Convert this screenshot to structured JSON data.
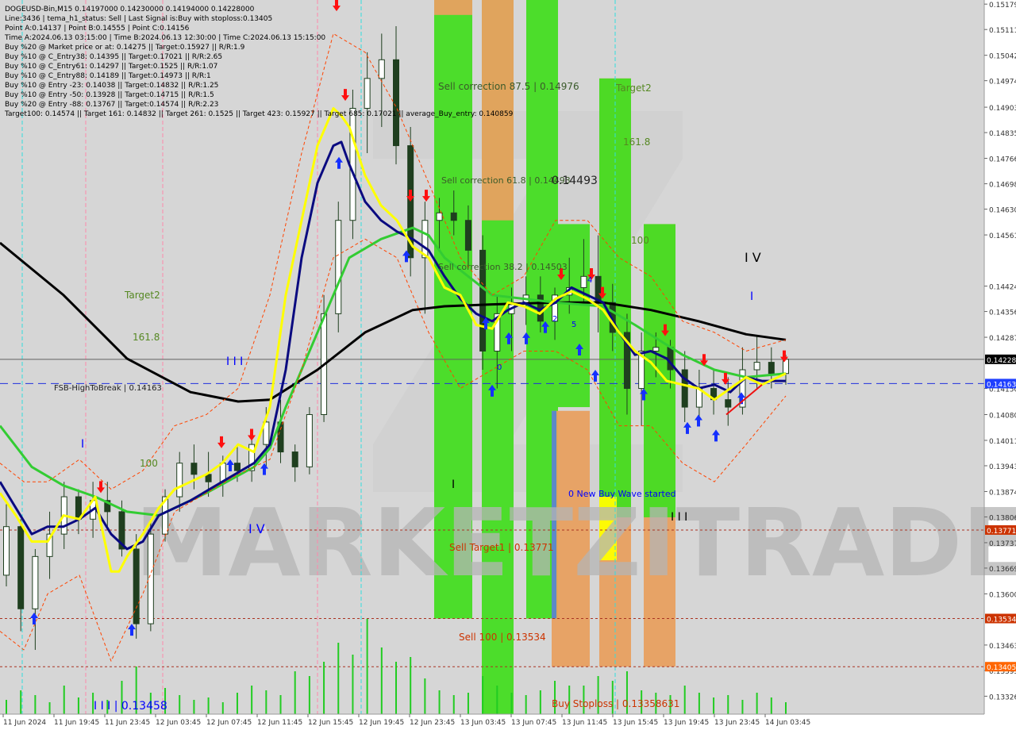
{
  "header": {
    "title": "DOGEUSD-Bin,M15  0.14197000 0.14230000 0.14194000 0.14228000",
    "lines": [
      "Line:3436 | tema_h1_status: Sell | Last Signal is:Buy with stoploss:0.13405",
      "Point A:0.14137 | Point B:0.14555 | Point C:0.14156",
      "Time A:2024.06.13 03:15:00 | Time B:2024.06.13 12:30:00 | Time C:2024.06.13 15:15:00",
      "Buy %20 @ Market price or at: 0.14275 || Target:0.15927 || R/R:1.9",
      "Buy %10 @ C_Entry38: 0.14395 || Target:0.17021 || R/R:2.65",
      "Buy %10 @ C_Entry61: 0.14297 || Target:0.1525 || R/R:1.07",
      "Buy %10 @ C_Entry88: 0.14189 || Target:0.14973 || R/R:1",
      "Buy %10 @ Entry -23: 0.14038 || Target:0.14832 || R/R:1.25",
      "Buy %10 @ Entry -50: 0.13928 || Target:0.14715 || R/R:1.5",
      "Buy %20 @ Entry -88: 0.13767 || Target:0.14574 || R/R:2.23",
      "Target100: 0.14574 || Target 161: 0.14832 || Target 261: 0.1525 || Target 423: 0.15927 || Target 685: 0.17021 || average_Buy_entry: 0.140859"
    ]
  },
  "watermark": "MARKETZITRADE",
  "colors": {
    "background": "#ffffff",
    "plot_bg": "#d6d6d6",
    "candle": "#1f3f1f",
    "ema_black": "#000000",
    "ema_navy": "#0a0a80",
    "ema_green": "#33cc33",
    "ema_yellow": "#ffff00",
    "band_red": "#ff4400",
    "zone_green": "#44dd22",
    "zone_orange": "#e8a060",
    "zone_yellow": "#ffff00",
    "cyan_line": "#33dddd",
    "pink_line": "#ff88aa",
    "buy_arrow": "#1530ff",
    "sell_arrow": "#ff1010",
    "volume": "#22cc22",
    "label_red": "#cc3300",
    "label_blue": "#0000ff",
    "label_green": "#558822"
  },
  "chart_data": {
    "type": "candlestick",
    "symbol": "DOGEUSD-Bin",
    "timeframe": "M15",
    "ylim": [
      0.13278,
      0.1519
    ],
    "y_ticks": [
      "0.15179",
      "0.15111",
      "0.15042",
      "0.14974",
      "0.14903",
      "0.14835",
      "0.14766",
      "0.14698",
      "0.14630",
      "0.14561",
      "0.14424",
      "0.14356",
      "0.14287",
      "0.14150",
      "0.14080",
      "0.14011",
      "0.13943",
      "0.13874",
      "0.13806",
      "0.13737",
      "0.13669",
      "0.13600",
      "0.13463",
      "0.13395",
      "0.13326"
    ],
    "x_ticks": [
      "11 Jun 2024",
      "11 Jun 19:45",
      "11 Jun 23:45",
      "12 Jun 03:45",
      "12 Jun 07:45",
      "12 Jun 11:45",
      "12 Jun 15:45",
      "12 Jun 19:45",
      "12 Jun 23:45",
      "13 Jun 03:45",
      "13 Jun 07:45",
      "13 Jun 11:45",
      "13 Jun 15:45",
      "13 Jun 19:45",
      "13 Jun 23:45",
      "14 Jun 03:45"
    ],
    "price_tags": [
      {
        "text": "0.14228",
        "value": 0.14228,
        "color": "#000000"
      },
      {
        "text": "0.14163",
        "value": 0.14163,
        "color": "#1f3fff"
      },
      {
        "text": "0.13771",
        "value": 0.13771,
        "color": "#cc3300"
      },
      {
        "text": "0.13534",
        "value": 0.13534,
        "color": "#cc3300"
      },
      {
        "text": "0.13405",
        "value": 0.13405,
        "color": "#ff6600"
      }
    ],
    "horizontal_lines": [
      {
        "value": 0.14228,
        "style": "solid",
        "color": "#606060"
      },
      {
        "value": 0.14163,
        "style": "dashed",
        "color": "#1f2fdd"
      },
      {
        "value": 0.13771,
        "style": "dotted",
        "color": "#aa3322"
      },
      {
        "value": 0.13534,
        "style": "dotted",
        "color": "#aa3322"
      },
      {
        "value": 0.13405,
        "style": "dotted",
        "color": "#aa3322"
      }
    ],
    "annotations": [
      {
        "text": "Sell correction 87.5 | 0.14976",
        "color": "#3a5a2a"
      },
      {
        "text": "Sell correction 61.8 | 0.14493",
        "color": "#3a5a2a"
      },
      {
        "text": "Sell correction 38.2 | 0.14503",
        "color": "#3a5a2a"
      },
      {
        "text": "0.14493",
        "color": "#222222"
      },
      {
        "text": "Target2",
        "color": "#558822"
      },
      {
        "text": "161.8",
        "color": "#558822"
      },
      {
        "text": "100",
        "color": "#558822"
      },
      {
        "text": "Target2",
        "color": "#558822"
      },
      {
        "text": "161.8",
        "color": "#558822"
      },
      {
        "text": "100",
        "color": "#558822"
      },
      {
        "text": "FSB-HighToBreak | 0.14163",
        "color": "#222222"
      },
      {
        "text": "Sell Target1 | 0.13771",
        "color": "#cc3300"
      },
      {
        "text": "Sell 100 | 0.13534",
        "color": "#cc3300"
      },
      {
        "text": "Buy Stoploss | 0.13358631",
        "color": "#cc3300"
      },
      {
        "text": "0 New Buy Wave started",
        "color": "#0000ff"
      },
      {
        "text": "I I I | 0.13458",
        "color": "#0000ff"
      },
      {
        "text": "I V",
        "color": "#0000ff"
      },
      {
        "text": "I I I",
        "color": "#0000ff"
      },
      {
        "text": "I",
        "color": "#0000ff"
      },
      {
        "text": "I V",
        "color": "#000000"
      },
      {
        "text": "I",
        "color": "#0000ff"
      },
      {
        "text": "I I I",
        "color": "#000000"
      },
      {
        "text": "I",
        "color": "#000000"
      }
    ],
    "wave_markers": [
      "2",
      "4",
      "5",
      "0"
    ],
    "series": [
      {
        "name": "ema-slow",
        "color": "#000000",
        "x": [
          0,
          80,
          160,
          240,
          300,
          340,
          400,
          460,
          520,
          560,
          620,
          700,
          760,
          820,
          880,
          940,
          990
        ],
        "y": [
          0.1454,
          0.144,
          0.1423,
          0.1414,
          0.14115,
          0.1412,
          0.142,
          0.143,
          0.1436,
          0.1437,
          0.14375,
          0.1438,
          0.1438,
          0.1436,
          0.1433,
          0.14295,
          0.1428
        ]
      },
      {
        "name": "ema-mid",
        "color": "#33cc33",
        "x": [
          0,
          40,
          80,
          120,
          160,
          200,
          260,
          320,
          340,
          360,
          400,
          440,
          480,
          520,
          540,
          560,
          620,
          700,
          760,
          800,
          860,
          900,
          940,
          990
        ],
        "y": [
          0.1405,
          0.1394,
          0.1389,
          0.1386,
          0.1382,
          0.1381,
          0.1387,
          0.1394,
          0.1399,
          0.141,
          0.143,
          0.145,
          0.1455,
          0.1458,
          0.1456,
          0.145,
          0.144,
          0.1438,
          0.1437,
          0.1432,
          0.1424,
          0.142,
          0.1418,
          0.1419
        ]
      },
      {
        "name": "ema-fast",
        "color": "#0a0a80",
        "x": [
          0,
          20,
          40,
          60,
          80,
          100,
          120,
          140,
          160,
          180,
          200,
          240,
          280,
          320,
          340,
          360,
          380,
          400,
          420,
          430,
          440,
          460,
          480,
          500,
          520,
          540,
          560,
          580,
          600,
          620,
          640,
          660,
          680,
          700,
          720,
          740,
          760,
          780,
          800,
          820,
          840,
          860,
          880,
          900,
          920,
          940,
          960,
          990
        ],
        "y": [
          0.139,
          0.1383,
          0.1376,
          0.1378,
          0.1378,
          0.138,
          0.1383,
          0.1376,
          0.1372,
          0.1374,
          0.1381,
          0.1385,
          0.139,
          0.1395,
          0.14,
          0.142,
          0.145,
          0.147,
          0.148,
          0.1481,
          0.1475,
          0.1465,
          0.146,
          0.1457,
          0.1455,
          0.1452,
          0.1445,
          0.1439,
          0.1435,
          0.1433,
          0.1436,
          0.1438,
          0.1436,
          0.1438,
          0.1442,
          0.144,
          0.1438,
          0.143,
          0.1424,
          0.1425,
          0.1423,
          0.1418,
          0.1415,
          0.1416,
          0.1414,
          0.1418,
          0.1417,
          0.1417
        ]
      },
      {
        "name": "ema-yellow",
        "color": "#ffff00",
        "x": [
          0,
          20,
          40,
          60,
          80,
          100,
          120,
          140,
          150,
          160,
          180,
          200,
          220,
          260,
          280,
          300,
          320,
          340,
          360,
          380,
          400,
          420,
          430,
          440,
          460,
          480,
          500,
          520,
          540,
          560,
          580,
          600,
          620,
          640,
          660,
          680,
          700,
          720,
          740,
          760,
          780,
          800,
          820,
          840,
          860,
          880,
          900,
          920,
          940,
          960,
          990
        ],
        "y": [
          0.1387,
          0.1381,
          0.1374,
          0.1374,
          0.1381,
          0.138,
          0.1386,
          0.1366,
          0.1366,
          0.137,
          0.1376,
          0.1383,
          0.1388,
          0.1392,
          0.1395,
          0.14,
          0.1398,
          0.141,
          0.144,
          0.146,
          0.148,
          0.149,
          0.1488,
          0.1485,
          0.1472,
          0.1464,
          0.146,
          0.1453,
          0.145,
          0.1442,
          0.144,
          0.1432,
          0.1431,
          0.1438,
          0.1437,
          0.1435,
          0.1439,
          0.1441,
          0.1439,
          0.1436,
          0.143,
          0.1425,
          0.1422,
          0.1417,
          0.1416,
          0.1415,
          0.1412,
          0.1415,
          0.1418,
          0.1416,
          0.1419
        ]
      },
      {
        "name": "red-upper",
        "color": "#ff4400",
        "x": [
          0,
          30,
          60,
          100,
          140,
          180,
          220,
          260,
          300,
          340,
          380,
          420,
          460,
          500,
          540,
          580,
          620,
          660,
          700,
          740,
          780,
          820,
          860,
          900,
          940,
          990
        ],
        "y": [
          0.1395,
          0.139,
          0.139,
          0.1396,
          0.1388,
          0.1393,
          0.1405,
          0.1408,
          0.1415,
          0.144,
          0.1478,
          0.151,
          0.1505,
          0.149,
          0.147,
          0.145,
          0.144,
          0.1445,
          0.146,
          0.146,
          0.145,
          0.1445,
          0.1433,
          0.143,
          0.1425,
          0.1428
        ]
      },
      {
        "name": "red-lower",
        "color": "#ff4400",
        "x": [
          0,
          30,
          60,
          100,
          140,
          180,
          220,
          260,
          300,
          340,
          380,
          420,
          460,
          500,
          540,
          580,
          620,
          660,
          700,
          740,
          780,
          820,
          860,
          900,
          940,
          990
        ],
        "y": [
          0.135,
          0.1345,
          0.136,
          0.1365,
          0.1342,
          0.136,
          0.1382,
          0.1387,
          0.1392,
          0.1396,
          0.142,
          0.145,
          0.1455,
          0.145,
          0.143,
          0.1415,
          0.142,
          0.1425,
          0.1425,
          0.142,
          0.1405,
          0.1405,
          0.1395,
          0.139,
          0.14,
          0.1413
        ]
      }
    ],
    "candles": [
      [
        0.1365,
        0.1384,
        0.1362,
        0.1378
      ],
      [
        0.1378,
        0.138,
        0.135,
        0.1356
      ],
      [
        0.1356,
        0.1372,
        0.1345,
        0.137
      ],
      [
        0.137,
        0.1382,
        0.1364,
        0.1376
      ],
      [
        0.1376,
        0.139,
        0.1372,
        0.1386
      ],
      [
        0.1386,
        0.1388,
        0.1376,
        0.138
      ],
      [
        0.138,
        0.139,
        0.1375,
        0.1385
      ],
      [
        0.1385,
        0.139,
        0.1378,
        0.1382
      ],
      [
        0.1382,
        0.1385,
        0.137,
        0.1372
      ],
      [
        0.1372,
        0.1376,
        0.1348,
        0.1352
      ],
      [
        0.1352,
        0.138,
        0.135,
        0.1376
      ],
      [
        0.1376,
        0.1388,
        0.1374,
        0.1386
      ],
      [
        0.1386,
        0.1398,
        0.1382,
        0.1395
      ],
      [
        0.1395,
        0.14,
        0.1388,
        0.1392
      ],
      [
        0.1392,
        0.1398,
        0.1386,
        0.139
      ],
      [
        0.139,
        0.1397,
        0.1386,
        0.1395
      ],
      [
        0.1395,
        0.14,
        0.139,
        0.1393
      ],
      [
        0.1393,
        0.1402,
        0.139,
        0.14
      ],
      [
        0.14,
        0.141,
        0.1394,
        0.1406
      ],
      [
        0.1406,
        0.1412,
        0.1395,
        0.1398
      ],
      [
        0.1398,
        0.14,
        0.139,
        0.1394
      ],
      [
        0.1394,
        0.141,
        0.1392,
        0.1408
      ],
      [
        0.1408,
        0.144,
        0.1406,
        0.1435
      ],
      [
        0.1435,
        0.1465,
        0.143,
        0.146
      ],
      [
        0.146,
        0.1495,
        0.1455,
        0.149
      ],
      [
        0.149,
        0.1505,
        0.1478,
        0.1498
      ],
      [
        0.1498,
        0.151,
        0.1485,
        0.1503
      ],
      [
        0.1503,
        0.1512,
        0.1475,
        0.148
      ],
      [
        0.148,
        0.1485,
        0.1445,
        0.145
      ],
      [
        0.145,
        0.1465,
        0.1435,
        0.146
      ],
      [
        0.146,
        0.1466,
        0.1452,
        0.1462
      ],
      [
        0.1462,
        0.1468,
        0.1456,
        0.146
      ],
      [
        0.146,
        0.1464,
        0.1448,
        0.1452
      ],
      [
        0.1452,
        0.1456,
        0.142,
        0.1425
      ],
      [
        0.1425,
        0.144,
        0.1415,
        0.1435
      ],
      [
        0.1435,
        0.1442,
        0.1425,
        0.1438
      ],
      [
        0.1438,
        0.1445,
        0.1432,
        0.144
      ],
      [
        0.144,
        0.1445,
        0.143,
        0.1433
      ],
      [
        0.1433,
        0.1442,
        0.1428,
        0.144
      ],
      [
        0.144,
        0.145,
        0.1435,
        0.1442
      ],
      [
        0.1442,
        0.1455,
        0.1438,
        0.1445
      ],
      [
        0.1445,
        0.1456,
        0.143,
        0.1438
      ],
      [
        0.1438,
        0.1443,
        0.1425,
        0.143
      ],
      [
        0.143,
        0.1435,
        0.1408,
        0.1415
      ],
      [
        0.1415,
        0.143,
        0.1405,
        0.1425
      ],
      [
        0.1425,
        0.143,
        0.1418,
        0.1426
      ],
      [
        0.1426,
        0.1428,
        0.1415,
        0.142
      ],
      [
        0.142,
        0.1425,
        0.1406,
        0.141
      ],
      [
        0.141,
        0.142,
        0.1405,
        0.1415
      ],
      [
        0.1415,
        0.142,
        0.1408,
        0.1412
      ],
      [
        0.1412,
        0.1418,
        0.1405,
        0.141
      ],
      [
        0.141,
        0.1426,
        0.1408,
        0.142
      ],
      [
        0.142,
        0.1429,
        0.1415,
        0.1422
      ],
      [
        0.1422,
        0.1426,
        0.1415,
        0.1419
      ],
      [
        0.1419,
        0.1424,
        0.1416,
        0.14228
      ]
    ],
    "volume": [
      6,
      10,
      8,
      5,
      12,
      7,
      9,
      6,
      14,
      20,
      9,
      11,
      8,
      6,
      7,
      5,
      9,
      12,
      10,
      8,
      18,
      16,
      22,
      30,
      25,
      40,
      28,
      22,
      24,
      15,
      10,
      8,
      9,
      16,
      12,
      9,
      8,
      10,
      14,
      12,
      12,
      16,
      14,
      18,
      10,
      9,
      8,
      12,
      9,
      7,
      8,
      6,
      9,
      7,
      5
    ],
    "buy_arrow_count": 18,
    "sell_arrow_count": 11
  }
}
